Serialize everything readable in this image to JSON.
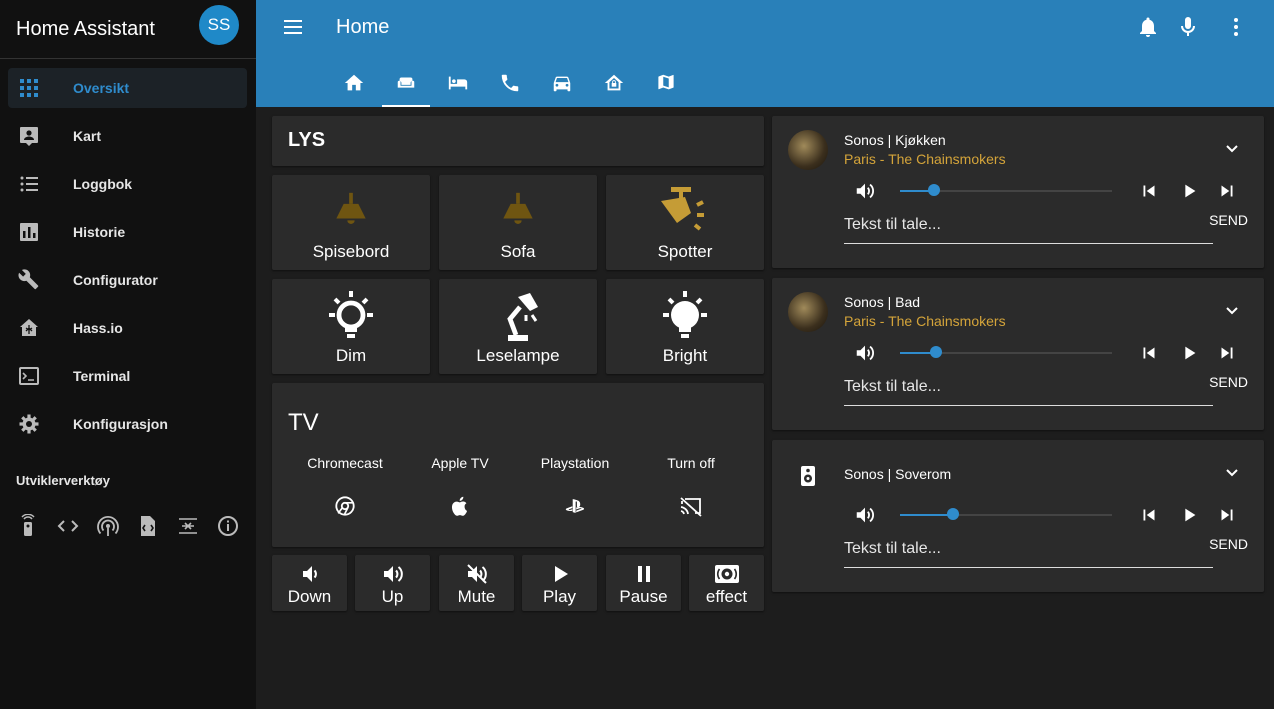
{
  "sidebar": {
    "title": "Home Assistant",
    "avatar": "SS",
    "items": [
      {
        "label": "Oversikt",
        "icon": "view-dashboard-icon",
        "active": true
      },
      {
        "label": "Kart",
        "icon": "account-location-icon"
      },
      {
        "label": "Loggbok",
        "icon": "format-list-bulleted-icon"
      },
      {
        "label": "Historie",
        "icon": "chart-box-icon"
      },
      {
        "label": "Configurator",
        "icon": "wrench-icon"
      },
      {
        "label": "Hass.io",
        "icon": "home-assistant-icon"
      },
      {
        "label": "Terminal",
        "icon": "console-icon"
      },
      {
        "label": "Konfigurasjon",
        "icon": "settings-icon"
      }
    ],
    "developer_title": "Utviklerverktøy",
    "developer_icons": [
      "remote-icon",
      "code-brackets-icon",
      "access-point-icon",
      "file-xml-icon",
      "format-align-middle-icon",
      "information-outline-icon"
    ]
  },
  "header": {
    "title": "Home",
    "tabs": [
      "home-icon",
      "sofa-icon",
      "bed-icon",
      "phone-icon",
      "car-icon",
      "home-lock-icon",
      "map-icon"
    ],
    "active_tab": 1,
    "colors": {
      "primary": "#2980b9",
      "accent": "#2f8ccd",
      "light_off": "#6f5511",
      "light_on": "#c59c36"
    }
  },
  "lights": {
    "title": "LYS",
    "buttons": [
      {
        "name": "Spisebord",
        "icon": "ceiling-light-icon",
        "state": "on"
      },
      {
        "name": "Sofa",
        "icon": "ceiling-light-icon",
        "state": "on"
      },
      {
        "name": "Spotter",
        "icon": "spotlight-beam-icon",
        "state": "on"
      },
      {
        "name": "Dim",
        "icon": "lightbulb-on-outline-icon",
        "state": "off"
      },
      {
        "name": "Leselampe",
        "icon": "desk-lamp-icon",
        "state": "off"
      },
      {
        "name": "Bright",
        "icon": "lightbulb-on-icon",
        "state": "off"
      }
    ]
  },
  "tv": {
    "title": "TV",
    "sources": [
      {
        "label": "Chromecast",
        "icon": "google-chrome-icon"
      },
      {
        "label": "Apple TV",
        "icon": "apple-icon"
      },
      {
        "label": "Playstation",
        "icon": "playstation-icon"
      },
      {
        "label": "Turn off",
        "icon": "cast-off-icon"
      }
    ]
  },
  "controls": [
    {
      "label": "Down",
      "icon": "volume-low-icon"
    },
    {
      "label": "Up",
      "icon": "volume-high-icon"
    },
    {
      "label": "Mute",
      "icon": "volume-off-icon"
    },
    {
      "label": "Play",
      "icon": "play-icon"
    },
    {
      "label": "Pause",
      "icon": "pause-icon"
    },
    {
      "label": "effect",
      "icon": "surround-sound-icon"
    }
  ],
  "media_players": [
    {
      "name": "Sonos | Kjøkken",
      "track": "Paris - The Chainsmokers",
      "volume": 0.16,
      "tts_placeholder": "Tekst til tale...",
      "send_label": "SEND",
      "has_art": true
    },
    {
      "name": "Sonos | Bad",
      "track": "Paris - The Chainsmokers",
      "volume": 0.17,
      "tts_placeholder": "Tekst til tale...",
      "send_label": "SEND",
      "has_art": true
    },
    {
      "name": "Sonos | Soverom",
      "track": "",
      "volume": 0.25,
      "tts_placeholder": "Tekst til tale...",
      "send_label": "SEND",
      "has_art": false
    }
  ]
}
